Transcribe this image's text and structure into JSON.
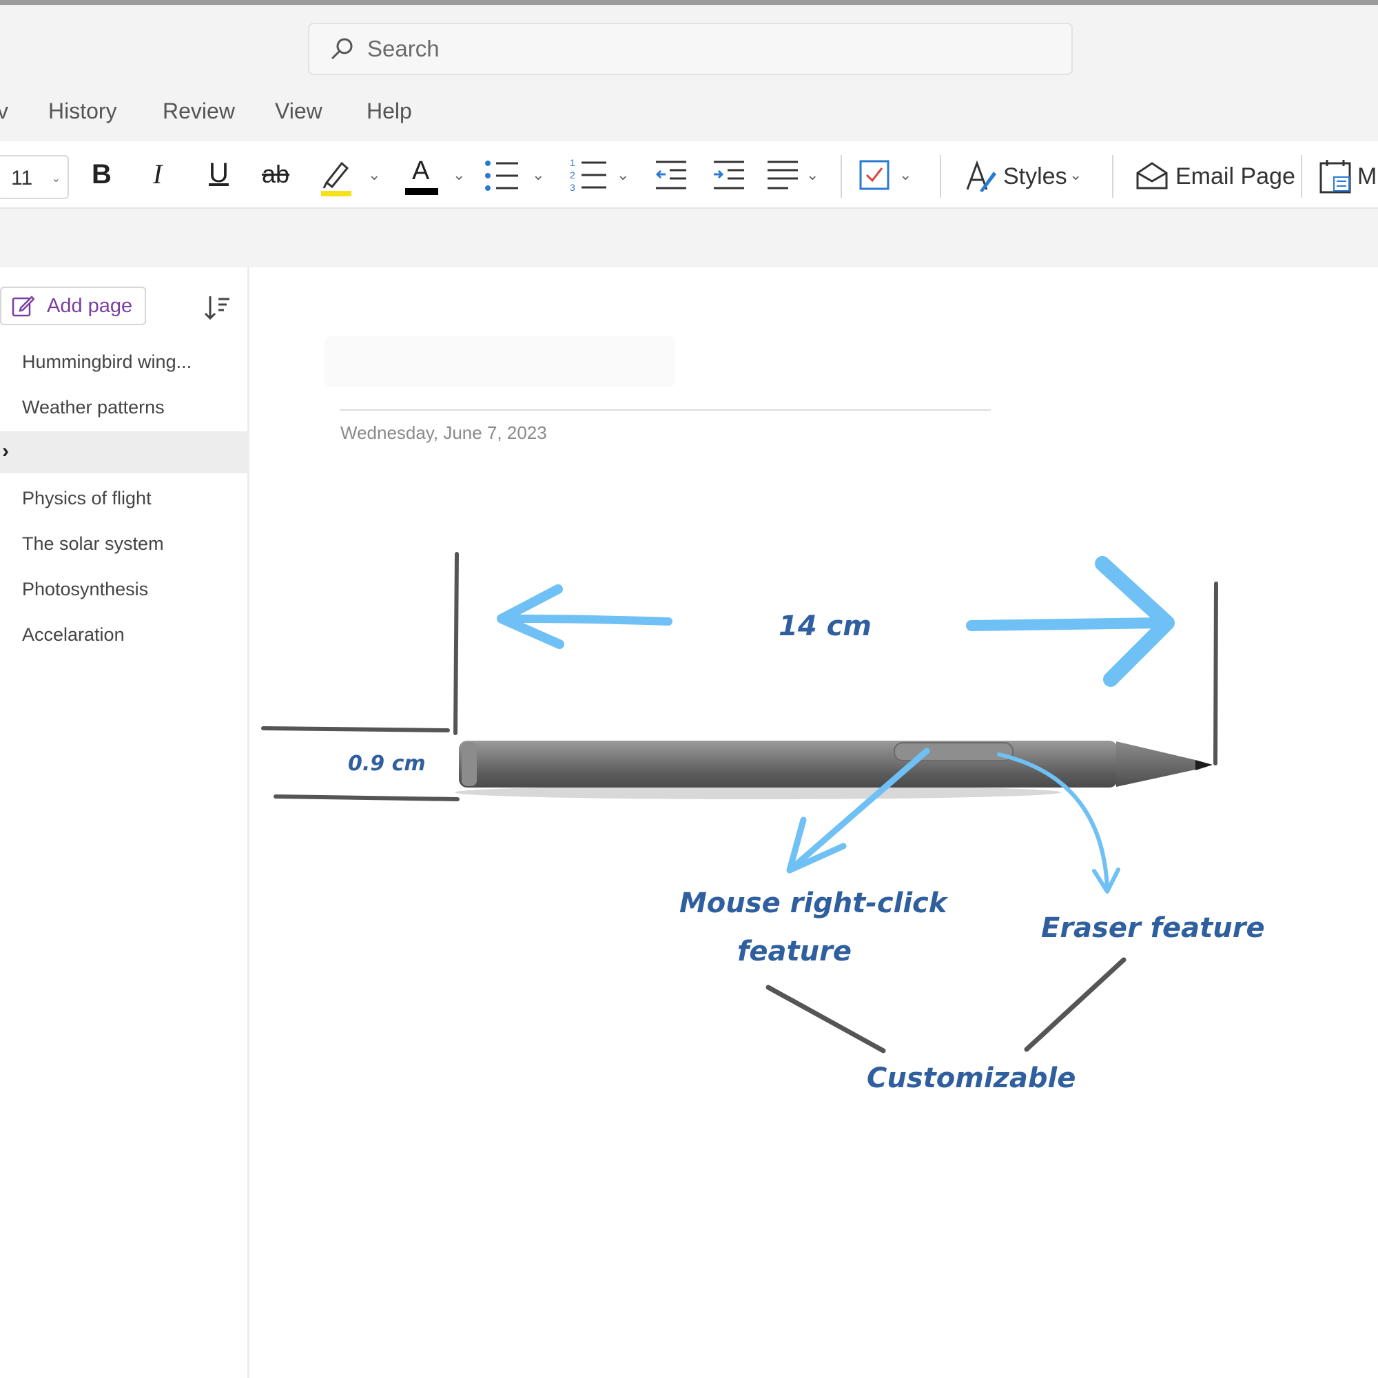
{
  "search": {
    "placeholder": "Search"
  },
  "menu": {
    "partial": "v",
    "items": [
      "History",
      "Review",
      "View",
      "Help"
    ]
  },
  "ribbon": {
    "font_size": "11",
    "bold": "B",
    "italic": "I",
    "underline": "U",
    "strikethrough": "ab",
    "font_color_letter": "A",
    "styles_label": "Styles",
    "email_page_label": "Email Page",
    "truncated_label": "M",
    "highlight_color": "#f7e11b",
    "font_color": "#000000",
    "todo_check_color": "#d9453d"
  },
  "sidebar": {
    "add_page_label": "Add page",
    "pages": [
      "Hummingbird wing...",
      "Weather patterns",
      "",
      "Physics of flight",
      "The solar system",
      "Photosynthesis",
      "Accelaration"
    ],
    "selected_index": 2,
    "accent_color": "#7a3fa0"
  },
  "page": {
    "date": "Wednesday, June 7, 2023"
  },
  "ink": {
    "length_label": "14  cm",
    "width_label": "0.9 cm",
    "right_click_label_line1": "Mouse right-click",
    "right_click_label_line2": "feature",
    "eraser_label": "Eraser feature",
    "customizable_label": "Customizable",
    "arrow_color": "#6fc0f4",
    "text_color": "#2f5f9e",
    "pen_color": "#6d6d6d"
  }
}
